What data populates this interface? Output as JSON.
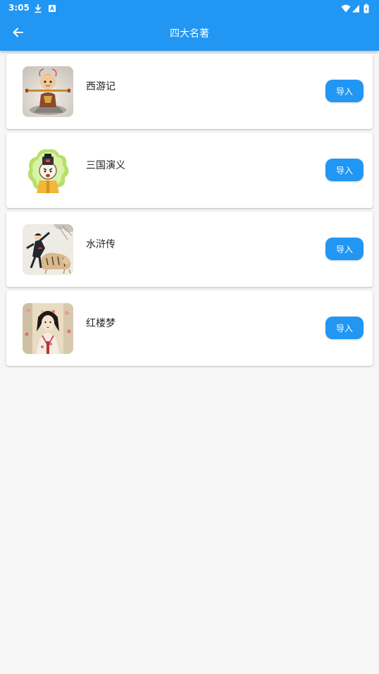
{
  "status": {
    "time": "3:05",
    "icons": [
      "download-icon",
      "a-badge-icon",
      "wifi-icon",
      "signal-icon",
      "battery-icon"
    ]
  },
  "toolbar": {
    "title": "四大名著",
    "back_icon": "arrow-left-icon"
  },
  "colors": {
    "primary": "#2196f3",
    "background": "#f6f6f6",
    "card": "#ffffff"
  },
  "books": [
    {
      "title": "西游记",
      "button": "导入",
      "image": "monkey-king-illustration"
    },
    {
      "title": "三国演义",
      "button": "导入",
      "image": "cartoon-official-illustration"
    },
    {
      "title": "水浒传",
      "button": "导入",
      "image": "hero-with-tiger-illustration"
    },
    {
      "title": "红楼梦",
      "button": "导入",
      "image": "classical-lady-illustration"
    }
  ]
}
